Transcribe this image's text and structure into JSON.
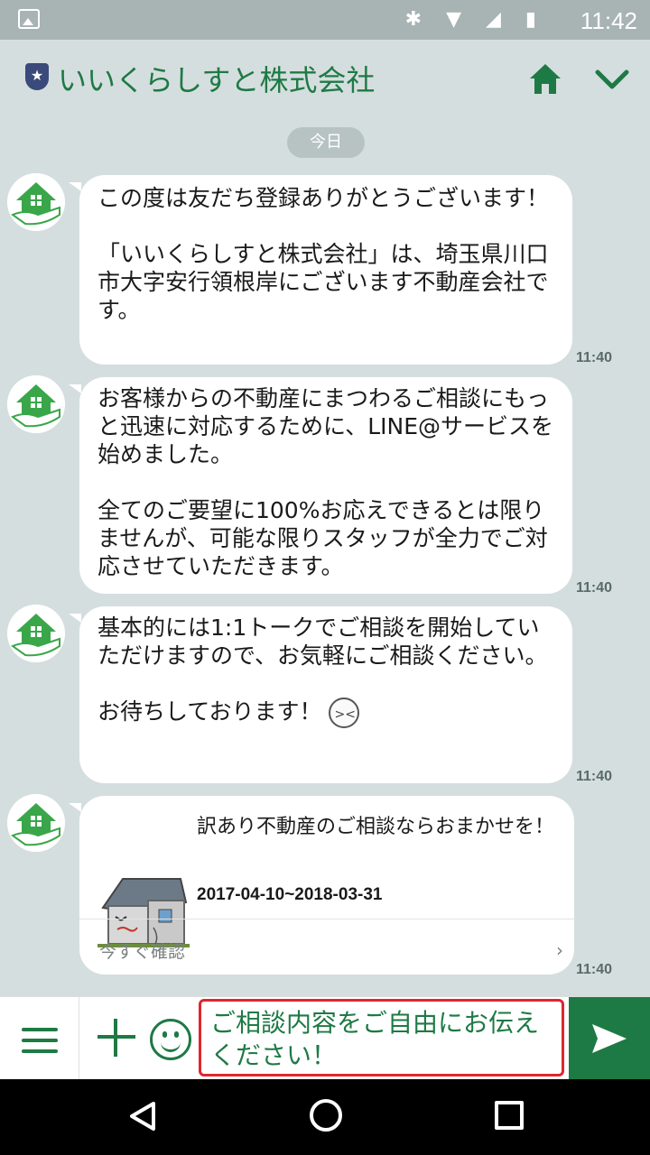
{
  "status_bar": {
    "time": "11:42",
    "icons": [
      "gallery-icon",
      "bluetooth-icon",
      "wifi-icon",
      "signal-icon",
      "battery-icon"
    ]
  },
  "header": {
    "title": "いいくらしすと株式会社",
    "icons": [
      "shield-star-icon",
      "home-icon",
      "chevron-down-icon"
    ]
  },
  "chat": {
    "date_label": "今日",
    "messages": [
      {
        "text": "この度は友だち登録ありがとうございます！\n\n「いいくらしすと株式会社」は、埼玉県川口市大字安行領根岸にございます不動産会社です。",
        "time": "11:40"
      },
      {
        "text": "お客様からの不動産にまつわるご相談にもっと迅速に対応するために、LINE@サービスを始めました。\n\n全てのご要望に100%お応えできるとは限りませんが、可能な限りスタッフが全力でご対応させていただきます。",
        "time": "11:40"
      },
      {
        "text": "基本的には1:1トークでご相談を開始していただけますので、お気軽にご相談ください。\n\n",
        "text_end": "お待ちしております！",
        "time": "11:40"
      },
      {
        "card_title": "訳あり不動産のご相談ならおまかせを！",
        "card_date": "2017-04-10~2018-03-31",
        "card_link": "今すぐ確認",
        "time": "11:40"
      }
    ]
  },
  "input": {
    "value": "ご相談内容をご自由にお伝えください！"
  },
  "colors": {
    "brand_green": "#1e7a45",
    "chat_bg": "#d5dede",
    "input_highlight": "#e0262e"
  }
}
